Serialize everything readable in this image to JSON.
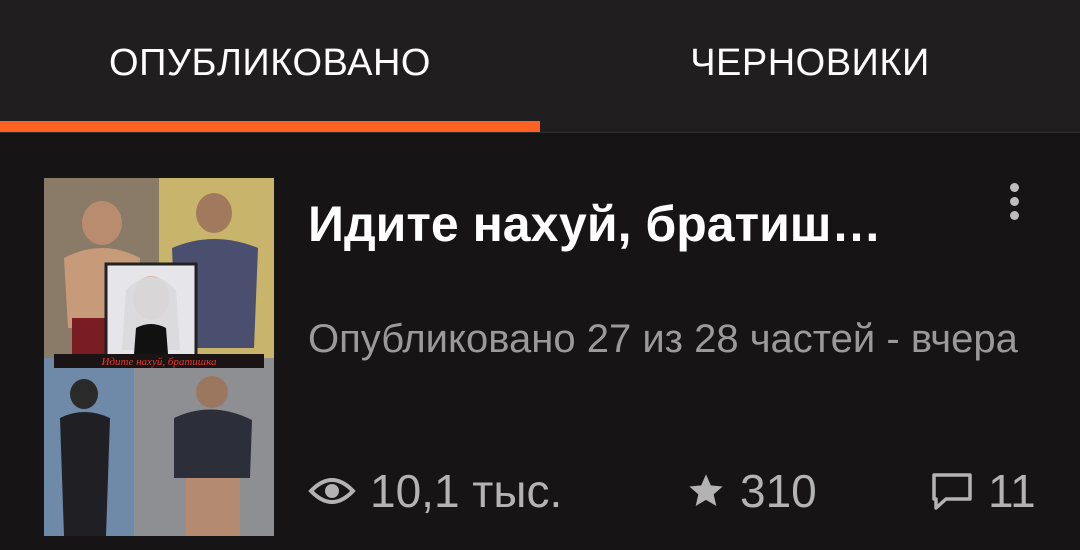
{
  "tabs": [
    {
      "label": "ОПУБЛИКОВАНО",
      "active": true
    },
    {
      "label": "ЧЕРНОВИКИ",
      "active": false
    }
  ],
  "colors": {
    "accent": "#ff6122",
    "background": "#121212",
    "tabbar": "#201e1f"
  },
  "story": {
    "title": "Идите нахуй, братиш…",
    "meta": "Опубликовано 27 из 28 частей - вчера",
    "cover_text": "Идите нахуй, братишка",
    "views": "10,1 тыс.",
    "votes": "310",
    "comments": "11",
    "icons": {
      "views": "eye-icon",
      "votes": "star-icon",
      "comments": "comment-icon",
      "menu": "more-vertical-icon"
    }
  }
}
